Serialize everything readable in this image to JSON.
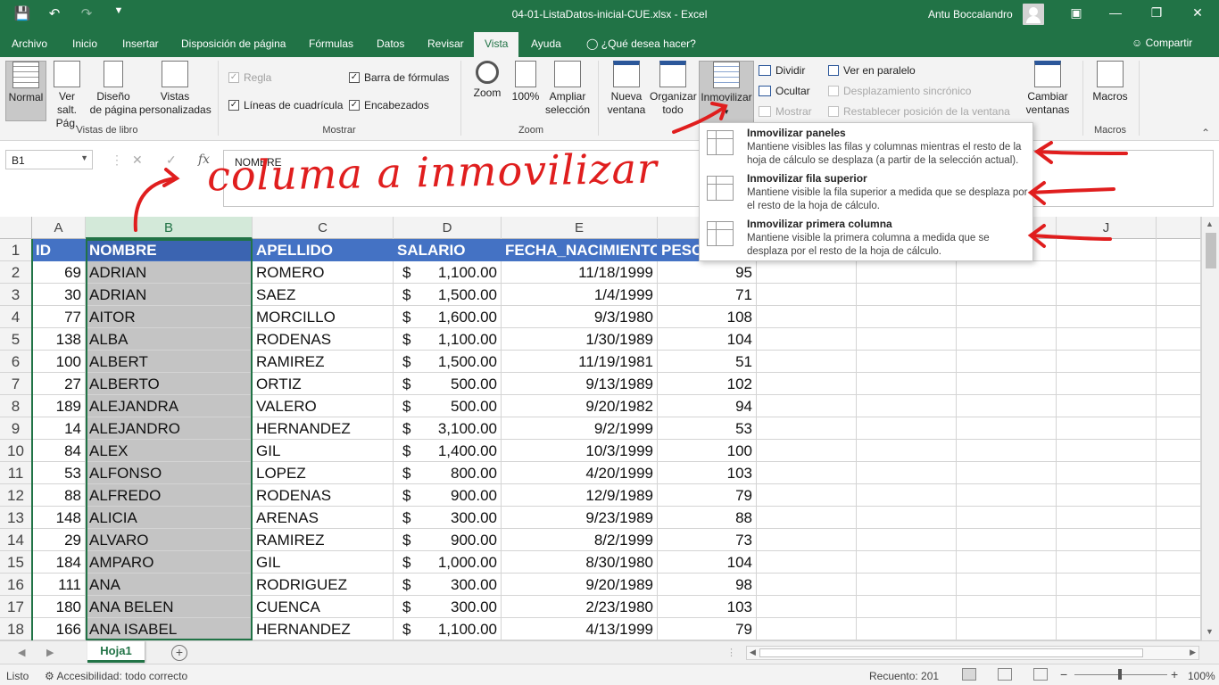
{
  "titlebar": {
    "doc_title": "04-01-ListaDatos-inicial-CUE.xlsx  -  Excel",
    "user": "Antu Boccalandro",
    "qat_icons": [
      "save-icon",
      "undo-icon",
      "redo-icon",
      "customize-icon"
    ],
    "color": "#217346"
  },
  "tabs": [
    "Archivo",
    "Inicio",
    "Insertar",
    "Disposición de página",
    "Fórmulas",
    "Datos",
    "Revisar",
    "Vista",
    "Ayuda"
  ],
  "active_tab": "Vista",
  "tell_me": "¿Qué desea hacer?",
  "share": "Compartir",
  "ribbon": {
    "workbook_views": {
      "label": "Vistas de libro",
      "buttons": [
        "Normal",
        "Ver salt.\nPág.",
        "Diseño\nde página",
        "Vistas\npersonalizadas"
      ]
    },
    "show": {
      "label": "Mostrar",
      "regla": "Regla",
      "barra": "Barra de fórmulas",
      "lineas": "Líneas de cuadrícula",
      "encabezados": "Encabezados"
    },
    "zoom": {
      "label": "Zoom",
      "zoom": "Zoom",
      "pct": "100%",
      "ampliar": "Ampliar\nselección"
    },
    "window": {
      "nueva": "Nueva\nventana",
      "organizar": "Organizar\ntodo",
      "inmovilizar": "Inmovilizar",
      "dividir": "Dividir",
      "ocultar": "Ocultar",
      "mostrar": "Mostrar",
      "paralelo": "Ver en paralelo",
      "sincronico": "Desplazamiento sincrónico",
      "restablecer": "Restablecer posición de la ventana",
      "cambiar": "Cambiar\nventanas"
    },
    "macros": {
      "label": "Macros",
      "button": "Macros"
    }
  },
  "namebox": "B1",
  "formula_value": "NOMBRE",
  "columns": [
    "A",
    "B",
    "C",
    "D",
    "E",
    "F",
    "G",
    "H",
    "I",
    "J"
  ],
  "rows": [
    {
      "n": "1",
      "a": "ID",
      "b": "NOMBRE",
      "c": "APELLIDO",
      "d_sym": "",
      "d": "SALARIO",
      "e": "FECHA_NACIMIENTO",
      "f": "PESO",
      "header": true
    },
    {
      "n": "2",
      "a": "69",
      "b": "ADRIAN",
      "c": "ROMERO",
      "d_sym": "$",
      "d": "1,100.00",
      "e": "11/18/1999",
      "f": "95"
    },
    {
      "n": "3",
      "a": "30",
      "b": "ADRIAN",
      "c": "SAEZ",
      "d_sym": "$",
      "d": "1,500.00",
      "e": "1/4/1999",
      "f": "71"
    },
    {
      "n": "4",
      "a": "77",
      "b": "AITOR",
      "c": "MORCILLO",
      "d_sym": "$",
      "d": "1,600.00",
      "e": "9/3/1980",
      "f": "108"
    },
    {
      "n": "5",
      "a": "138",
      "b": "ALBA",
      "c": "RODENAS",
      "d_sym": "$",
      "d": "1,100.00",
      "e": "1/30/1989",
      "f": "104"
    },
    {
      "n": "6",
      "a": "100",
      "b": "ALBERT",
      "c": "RAMIREZ",
      "d_sym": "$",
      "d": "1,500.00",
      "e": "11/19/1981",
      "f": "51"
    },
    {
      "n": "7",
      "a": "27",
      "b": "ALBERTO",
      "c": "ORTIZ",
      "d_sym": "$",
      "d": "500.00",
      "e": "9/13/1989",
      "f": "102"
    },
    {
      "n": "8",
      "a": "189",
      "b": "ALEJANDRA",
      "c": "VALERO",
      "d_sym": "$",
      "d": "500.00",
      "e": "9/20/1982",
      "f": "94"
    },
    {
      "n": "9",
      "a": "14",
      "b": "ALEJANDRO",
      "c": "HERNANDEZ",
      "d_sym": "$",
      "d": "3,100.00",
      "e": "9/2/1999",
      "f": "53"
    },
    {
      "n": "10",
      "a": "84",
      "b": "ALEX",
      "c": "GIL",
      "d_sym": "$",
      "d": "1,400.00",
      "e": "10/3/1999",
      "f": "100"
    },
    {
      "n": "11",
      "a": "53",
      "b": "ALFONSO",
      "c": "LOPEZ",
      "d_sym": "$",
      "d": "800.00",
      "e": "4/20/1999",
      "f": "103"
    },
    {
      "n": "12",
      "a": "88",
      "b": "ALFREDO",
      "c": "RODENAS",
      "d_sym": "$",
      "d": "900.00",
      "e": "12/9/1989",
      "f": "79"
    },
    {
      "n": "13",
      "a": "148",
      "b": "ALICIA",
      "c": "ARENAS",
      "d_sym": "$",
      "d": "300.00",
      "e": "9/23/1989",
      "f": "88"
    },
    {
      "n": "14",
      "a": "29",
      "b": "ALVARO",
      "c": "RAMIREZ",
      "d_sym": "$",
      "d": "900.00",
      "e": "8/2/1999",
      "f": "73"
    },
    {
      "n": "15",
      "a": "184",
      "b": "AMPARO",
      "c": "GIL",
      "d_sym": "$",
      "d": "1,000.00",
      "e": "8/30/1980",
      "f": "104"
    },
    {
      "n": "16",
      "a": "111",
      "b": "ANA",
      "c": "RODRIGUEZ",
      "d_sym": "$",
      "d": "300.00",
      "e": "9/20/1989",
      "f": "98"
    },
    {
      "n": "17",
      "a": "180",
      "b": "ANA BELEN",
      "c": "CUENCA",
      "d_sym": "$",
      "d": "300.00",
      "e": "2/23/1980",
      "f": "103"
    },
    {
      "n": "18",
      "a": "166",
      "b": "ANA ISABEL",
      "c": "HERNANDEZ",
      "d_sym": "$",
      "d": "1,100.00",
      "e": "4/13/1999",
      "f": "79"
    }
  ],
  "freeze_menu": [
    {
      "title": "Inmovilizar paneles",
      "desc": "Mantiene visibles las filas y columnas mientras el resto de la hoja de cálculo se desplaza (a partir de la selección actual)."
    },
    {
      "title": "Inmovilizar fila superior",
      "desc": "Mantiene visible la fila superior a medida que se desplaza por el resto de la hoja de cálculo."
    },
    {
      "title": "Inmovilizar primera columna",
      "desc": "Mantiene visible la primera columna a medida que se desplaza por el resto de la hoja de cálculo."
    }
  ],
  "annotation": "columa a inmovilizar",
  "sheet_tab": "Hoja1",
  "status": {
    "ready": "Listo",
    "accessibility": "Accesibilidad: todo correcto",
    "count": "Recuento: 201",
    "zoom": "100%"
  }
}
